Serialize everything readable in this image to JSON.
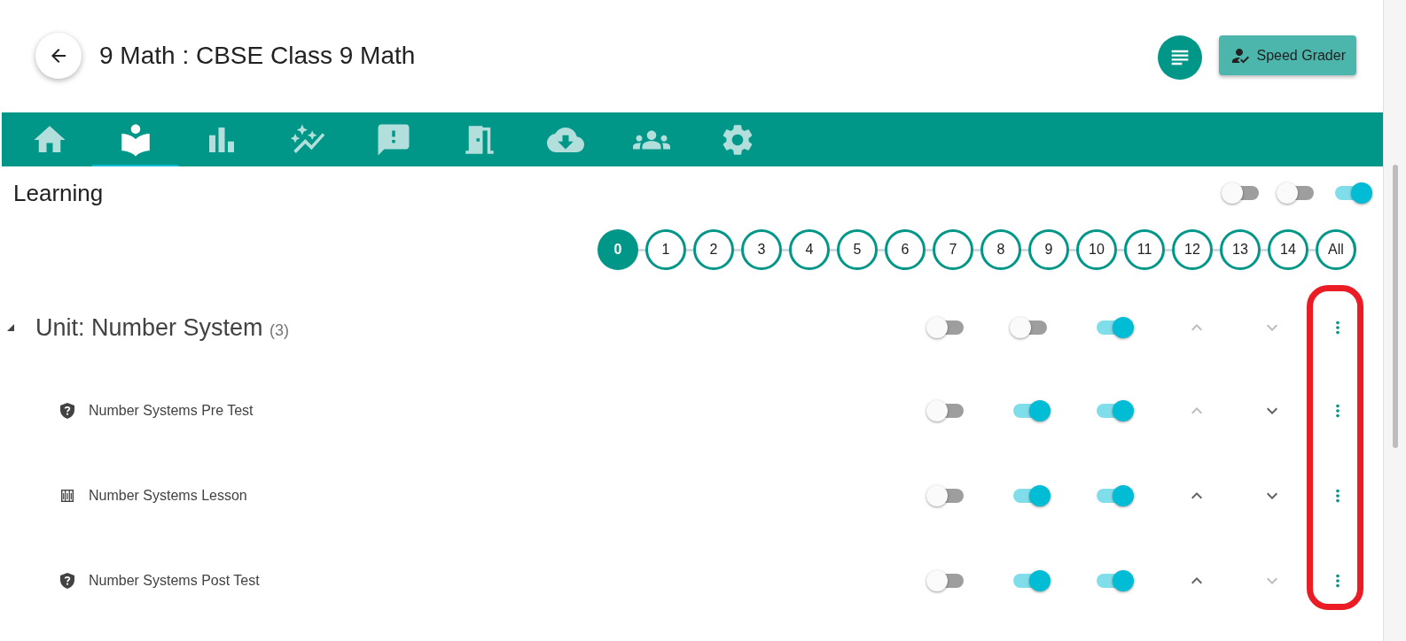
{
  "header": {
    "title": "9 Math : CBSE Class 9 Math",
    "speed_grader": "Speed Grader"
  },
  "tabs": [
    {
      "kind": "home",
      "selected": false
    },
    {
      "kind": "learning",
      "selected": true
    },
    {
      "kind": "stats",
      "selected": false
    },
    {
      "kind": "insights",
      "selected": false
    },
    {
      "kind": "feedback",
      "selected": false
    },
    {
      "kind": "door",
      "selected": false
    },
    {
      "kind": "download",
      "selected": false
    },
    {
      "kind": "people",
      "selected": false
    },
    {
      "kind": "settings",
      "selected": false
    }
  ],
  "section": {
    "title": "Learning",
    "toggles": [
      {
        "on": false
      },
      {
        "on": false
      },
      {
        "on": true
      }
    ]
  },
  "steps": [
    {
      "label": "0",
      "selected": true
    },
    {
      "label": "1",
      "selected": false
    },
    {
      "label": "2",
      "selected": false
    },
    {
      "label": "3",
      "selected": false
    },
    {
      "label": "4",
      "selected": false
    },
    {
      "label": "5",
      "selected": false
    },
    {
      "label": "6",
      "selected": false
    },
    {
      "label": "7",
      "selected": false
    },
    {
      "label": "8",
      "selected": false
    },
    {
      "label": "9",
      "selected": false
    },
    {
      "label": "10",
      "selected": false
    },
    {
      "label": "11",
      "selected": false
    },
    {
      "label": "12",
      "selected": false
    },
    {
      "label": "13",
      "selected": false
    },
    {
      "label": "14",
      "selected": false
    },
    {
      "label": "All",
      "selected": false
    }
  ],
  "unit": {
    "title": "Unit: Number System",
    "count": "(3)",
    "expanded": true,
    "toggles": [
      {
        "on": false
      },
      {
        "on": false
      },
      {
        "on": true
      }
    ],
    "up_disabled": true,
    "down_disabled": true,
    "items": [
      {
        "kind": "test",
        "title": "Number Systems Pre Test",
        "toggles": [
          {
            "on": false
          },
          {
            "on": true
          },
          {
            "on": true
          }
        ],
        "up_disabled": true,
        "down_disabled": false
      },
      {
        "kind": "lesson",
        "title": "Number Systems Lesson",
        "toggles": [
          {
            "on": false
          },
          {
            "on": true
          },
          {
            "on": true
          }
        ],
        "up_disabled": false,
        "down_disabled": false
      },
      {
        "kind": "test",
        "title": "Number Systems Post Test",
        "toggles": [
          {
            "on": false
          },
          {
            "on": true
          },
          {
            "on": true
          }
        ],
        "up_disabled": false,
        "down_disabled": true
      }
    ]
  }
}
